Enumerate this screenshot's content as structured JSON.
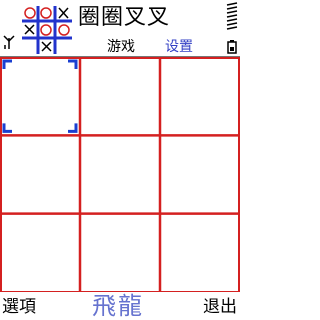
{
  "app": {
    "title": "圈圈叉叉"
  },
  "header": {
    "tabs": [
      {
        "label": "游戏",
        "active": false
      },
      {
        "label": "设置",
        "active": true
      }
    ]
  },
  "board": {
    "rows": 3,
    "cols": 3,
    "cells": [
      "",
      "",
      "",
      "",
      "",
      "",
      "",
      "",
      ""
    ],
    "selected_cell": 0,
    "line_color": "#d42020",
    "cursor_color": "#1a3fd0"
  },
  "softkeys": {
    "left": "選項",
    "right": "退出",
    "brand": "飛龍"
  },
  "colors": {
    "accent": "#3340c4",
    "brand": "#6673cf",
    "grid": "#d42020"
  }
}
